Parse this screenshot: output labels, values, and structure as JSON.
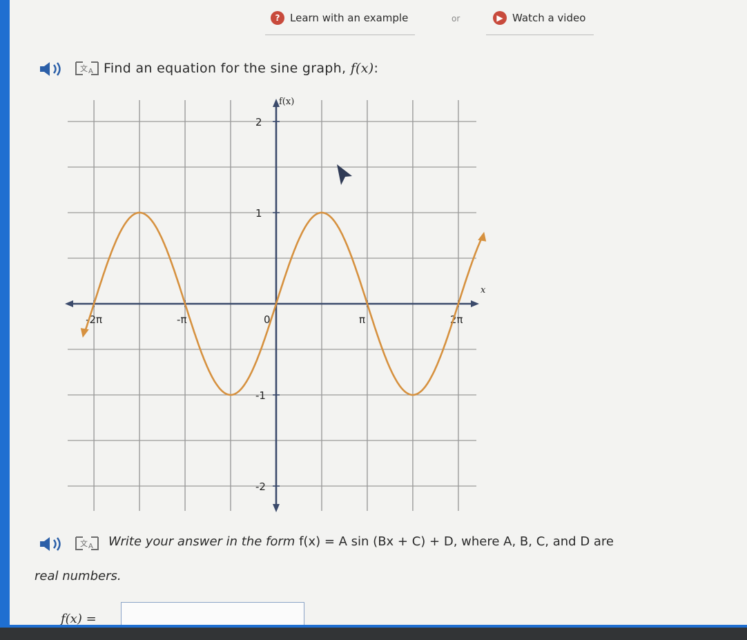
{
  "header": {
    "learn_label": "Learn with an example",
    "or_label": "or",
    "video_label": "Watch a video"
  },
  "question": {
    "prompt": "Find an equation for the sine graph, ",
    "fx": "f(x)",
    "prompt_end": ":",
    "instruction_before": "Write your answer in the form ",
    "instruction_formula": "f(x) = A sin (Bx + C) + D",
    "instruction_after": ", where A, B, C, and D are",
    "instruction_line2": "real numbers.",
    "answer_label": "f(x) =",
    "answer_value": ""
  },
  "icons": [
    "speaker-icon",
    "translate-icon",
    "lightbulb-icon",
    "play-icon",
    "cursor-icon"
  ],
  "chart_data": {
    "type": "line",
    "function": "sin(x)",
    "xlabel": "x",
    "ylabel": "f(x)",
    "x_ticks": [
      "-2π",
      "-π",
      "0",
      "π",
      "2π"
    ],
    "y_ticks": [
      "2",
      "1",
      "-1",
      "-2"
    ],
    "xlim": [
      -6.6,
      7.1
    ],
    "ylim": [
      -2.2,
      2.2
    ],
    "grid": true,
    "line_color": "#d6913f",
    "points": [
      {
        "x": -6.2832,
        "y": 0
      },
      {
        "x": -4.7124,
        "y": 1
      },
      {
        "x": -3.1416,
        "y": 0
      },
      {
        "x": -1.5708,
        "y": -1
      },
      {
        "x": 0,
        "y": 0
      },
      {
        "x": 1.5708,
        "y": 1
      },
      {
        "x": 3.1416,
        "y": 0
      },
      {
        "x": 4.7124,
        "y": -1
      },
      {
        "x": 6.2832,
        "y": 0
      }
    ]
  }
}
